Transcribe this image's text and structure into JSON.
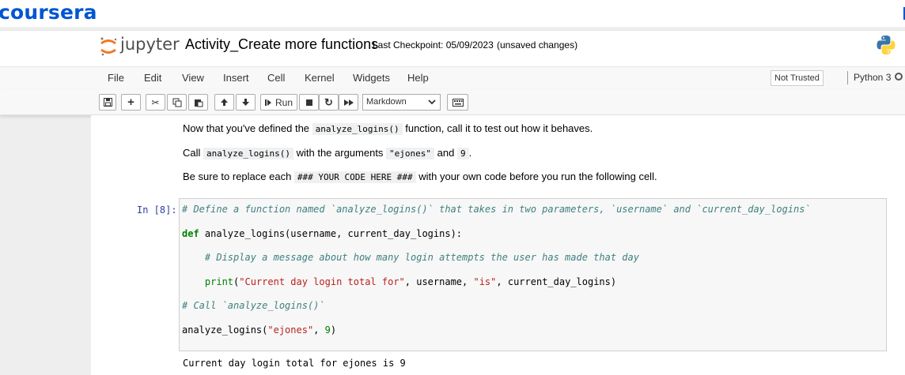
{
  "coursera": {
    "brand": "coursera"
  },
  "header": {
    "logo_text": "jupyter",
    "notebook_title": "Activity_Create more functions",
    "checkpoint": "Last Checkpoint: 05/09/2023",
    "save_status": "(unsaved changes)"
  },
  "menu": {
    "items": [
      "File",
      "Edit",
      "View",
      "Insert",
      "Cell",
      "Kernel",
      "Widgets",
      "Help"
    ],
    "trust_status": "Not Trusted",
    "kernel_name": "Python 3"
  },
  "toolbar": {
    "run_label": "Run",
    "cell_type": "Markdown"
  },
  "markdown": {
    "line1": {
      "a": "Now that you've defined the ",
      "code": "analyze_logins()",
      "b": " function, call it to test out how it behaves."
    },
    "line2": {
      "a": "Call ",
      "code1": "analyze_logins()",
      "b": " with the arguments ",
      "code2": "\"ejones\"",
      "c": " and ",
      "code3": "9",
      "d": "."
    },
    "line3": {
      "a": "Be sure to replace each ",
      "code": "### YOUR CODE HERE ###",
      "b": " with your own code before you run the following cell."
    }
  },
  "code_cell": {
    "prompt": "In [8]:",
    "l1": "# Define a function named `analyze_logins()` that takes in two parameters, `username` and `current_day_logins`",
    "l2_kw": "def",
    "l2_rest": " analyze_logins(username, current_day_logins):",
    "l3": "    # Display a message about how many login attempts the user has made that day",
    "l4_indent": "    ",
    "l4_fn": "print",
    "l4_p1": "(",
    "l4_s1": "\"Current day login total for\"",
    "l4_p2": ", username, ",
    "l4_s2": "\"is\"",
    "l4_p3": ", current_day_logins)",
    "l5": "# Call `analyze_logins()`",
    "l6_a": "analyze_logins(",
    "l6_s": "\"ejones\"",
    "l6_b": ", ",
    "l6_n": "9",
    "l6_c": ")"
  },
  "output": {
    "text": "Current day login total for ejones is 9"
  },
  "colors": {
    "coursera_blue": "#0056d2",
    "jupyter_orange": "#f37726",
    "prompt_blue": "#303f9f",
    "keyword_green": "#008000",
    "string_red": "#ba2121",
    "comment_teal": "#408080"
  }
}
